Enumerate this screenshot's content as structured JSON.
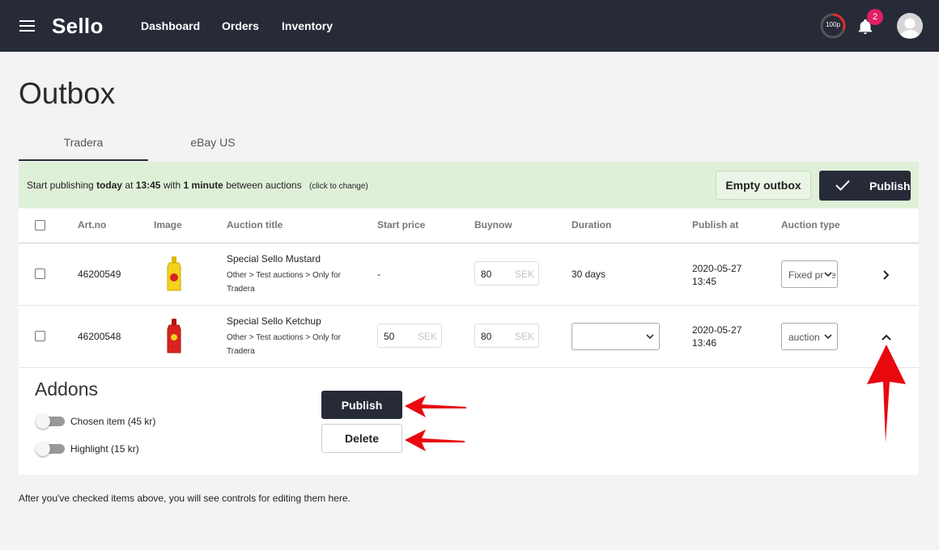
{
  "topbar": {
    "logo": "Sello",
    "nav": [
      "Dashboard",
      "Orders",
      "Inventory"
    ],
    "quota_label": "100p",
    "notification_count": "2"
  },
  "page": {
    "title": "Outbox"
  },
  "tabs": [
    {
      "label": "Tradera",
      "active": true
    },
    {
      "label": "eBay US",
      "active": false
    }
  ],
  "banner": {
    "prefix": "Start publishing",
    "day": "today",
    "at": "at",
    "time": "13:45",
    "with": "with",
    "interval": "1 minute",
    "suffix": "between auctions",
    "hint": "(click to change)",
    "empty_label": "Empty outbox",
    "publish_label": "Publish"
  },
  "table": {
    "headers": [
      "Art.no",
      "Image",
      "Auction title",
      "Start price",
      "Buynow",
      "Duration",
      "Publish at",
      "Auction type"
    ],
    "rows": [
      {
        "art_no": "46200549",
        "product_color": "#f2d21d",
        "title": "Special Sello Mustard",
        "category": "Other > Test auctions > Only for Tradera",
        "start_price": "-",
        "buynow_value": "80",
        "currency": "SEK",
        "duration": "30 days",
        "publish_date": "2020-05-27",
        "publish_time": "13:45",
        "auction_type": "Fixed price",
        "expand_icon": "chevron-right-icon"
      },
      {
        "art_no": "46200548",
        "product_color": "#d9231f",
        "title": "Special Sello Ketchup",
        "category": "Other > Test auctions > Only for Tradera",
        "start_price_value": "50",
        "buynow_value": "80",
        "currency": "SEK",
        "duration": "",
        "publish_date": "2020-05-27",
        "publish_time": "13:46",
        "auction_type": "auction",
        "expand_icon": "chevron-up-icon"
      }
    ]
  },
  "addons": {
    "title": "Addons",
    "items": [
      "Chosen item (45 kr)",
      "Highlight (15 kr)"
    ],
    "publish_label": "Publish",
    "delete_label": "Delete"
  },
  "footer": {
    "note": "After you've checked items above, you will see controls for editing them here."
  },
  "colors": {
    "topbar": "#272b38",
    "banner": "#dff0d8",
    "badge": "#e21f63",
    "annotation": "#e8080e"
  }
}
